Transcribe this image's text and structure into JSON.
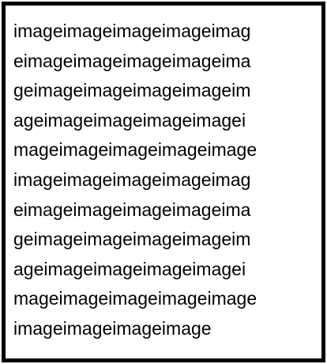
{
  "text": {
    "lines": [
      "imageimageimageimageimag",
      "eimageimageimageimageima",
      "geimageimageimageimageim",
      "ageimageimageimageimagei",
      "mageimageimageimageimage",
      "imageimageimageimageimag",
      "eimageimageimageimageima",
      "geimageimageimageimageim",
      "ageimageimageimageimagei",
      "mageimageimageimageimage",
      "imageimageimageimage"
    ]
  }
}
